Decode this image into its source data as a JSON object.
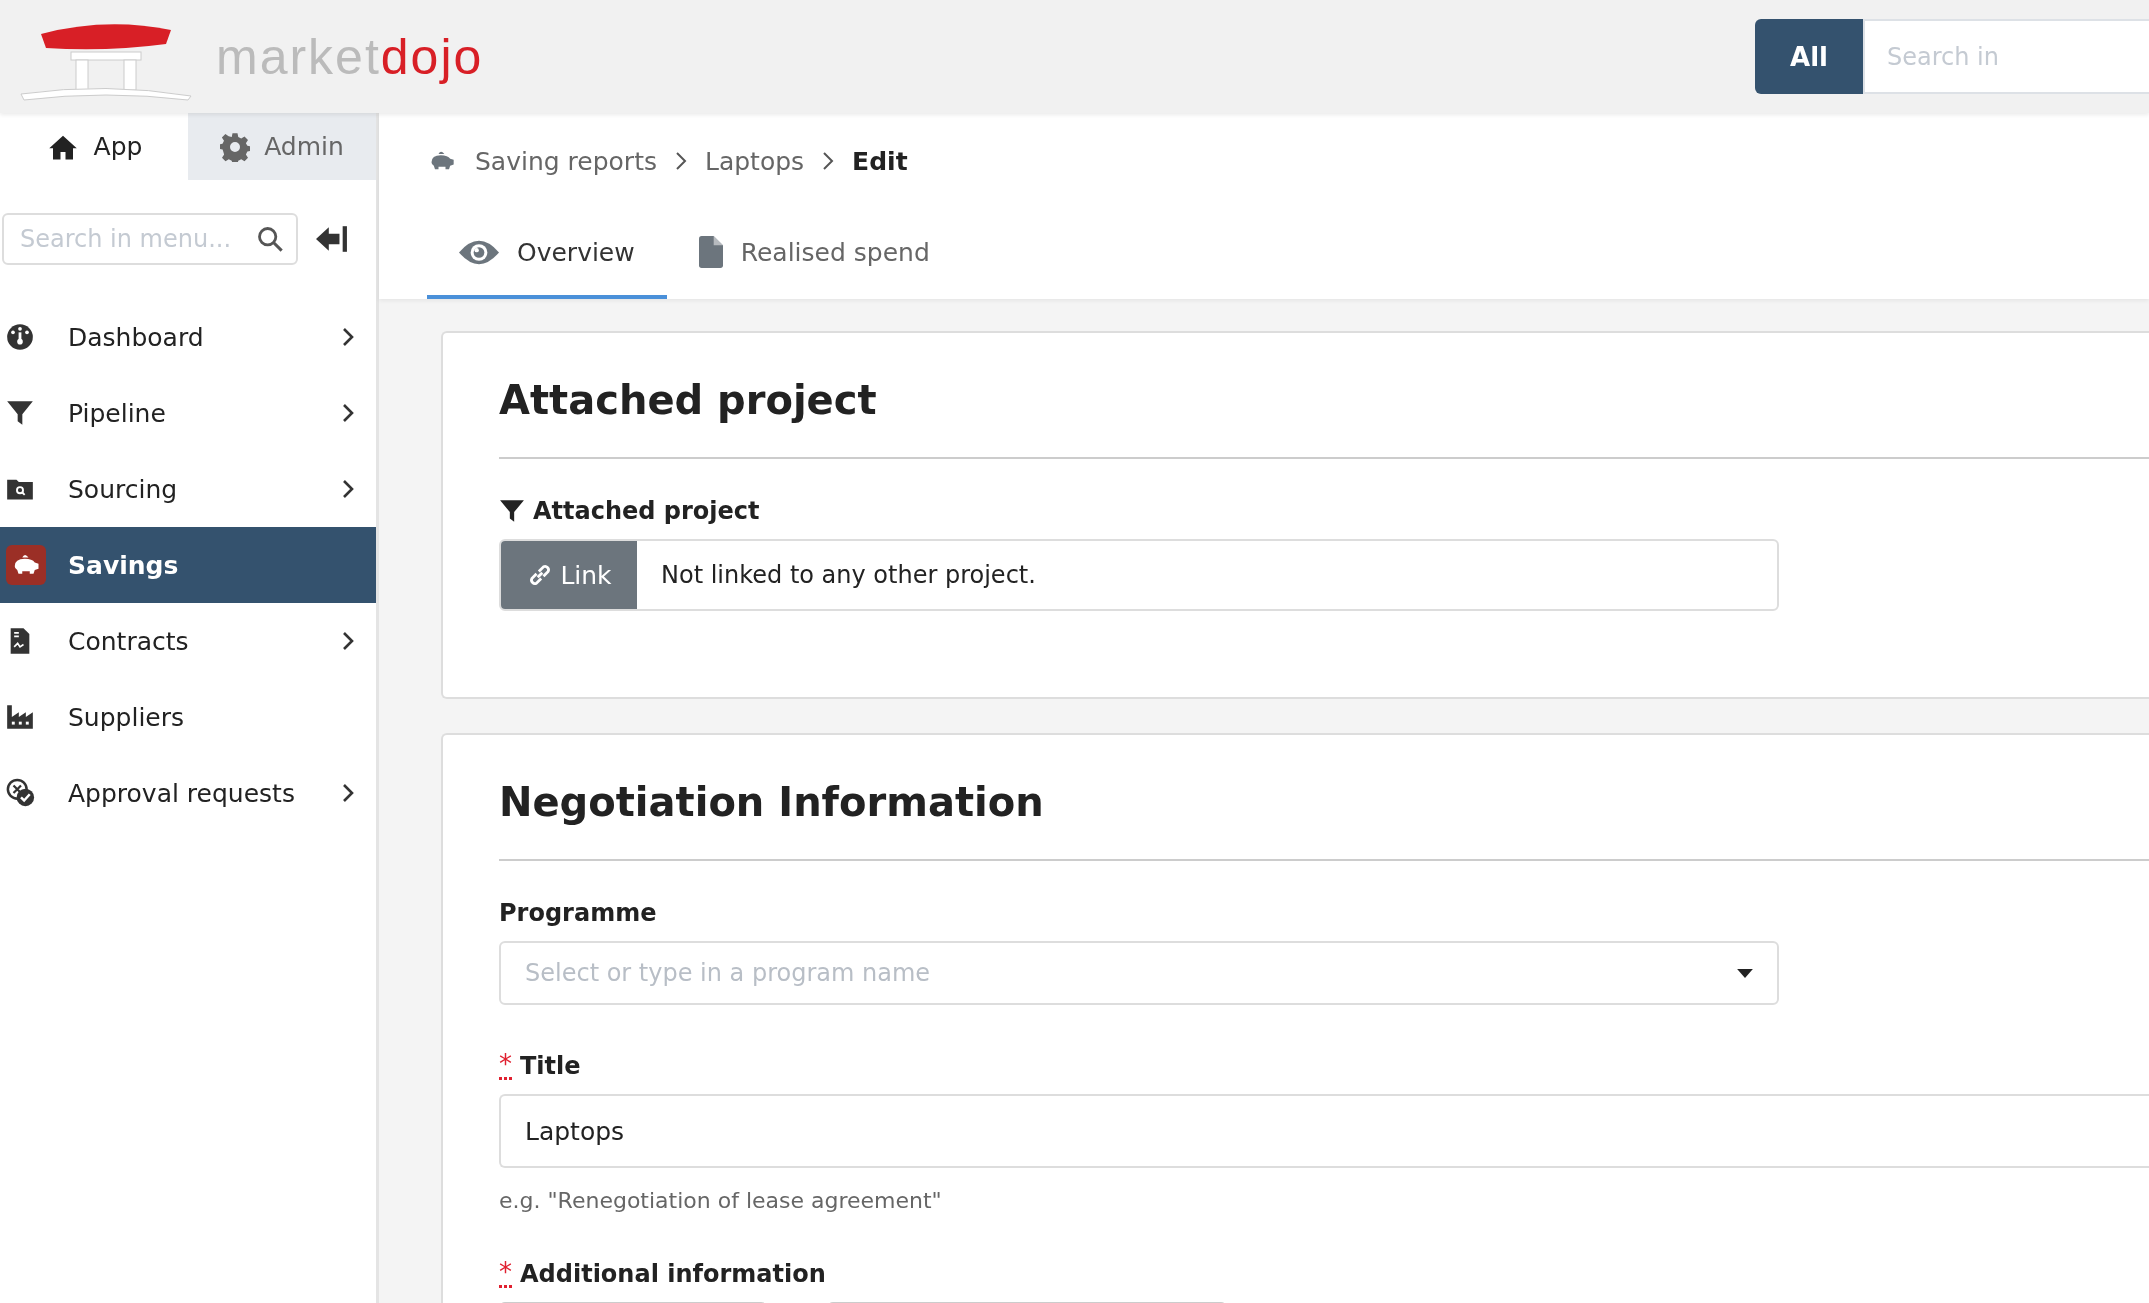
{
  "header": {
    "logo": {
      "part_1": "market",
      "part_2": "dojo"
    },
    "search_scope": "All",
    "search_placeholder": "Search in"
  },
  "sidebar": {
    "tabs": [
      {
        "label": "App",
        "selected": true,
        "kind": "home"
      },
      {
        "label": "Admin",
        "selected": false,
        "kind": "gear"
      }
    ],
    "search_placeholder": "Search in menu...",
    "items": [
      {
        "label": "Dashboard",
        "kind": "dashboard",
        "selected": false,
        "has_children": true
      },
      {
        "label": "Pipeline",
        "kind": "funnel",
        "selected": false,
        "has_children": true
      },
      {
        "label": "Sourcing",
        "kind": "folder",
        "selected": false,
        "has_children": true
      },
      {
        "label": "Savings",
        "kind": "piggy",
        "selected": true,
        "has_children": false
      },
      {
        "label": "Contracts",
        "kind": "contract",
        "selected": false,
        "has_children": true
      },
      {
        "label": "Suppliers",
        "kind": "factory",
        "selected": false,
        "has_children": false
      },
      {
        "label": "Approval requests",
        "kind": "approval",
        "selected": false,
        "has_children": true
      }
    ]
  },
  "breadcrumbs": [
    {
      "label": "Saving reports",
      "current": false
    },
    {
      "label": "Laptops",
      "current": false
    },
    {
      "label": "Edit",
      "current": true
    }
  ],
  "tabs": [
    {
      "label": "Overview",
      "selected": true,
      "kind": "eye"
    },
    {
      "label": "Realised spend",
      "selected": false,
      "kind": "file"
    }
  ],
  "sections": [
    {
      "title": "Attached project",
      "fields": [
        {
          "kind": "link",
          "label": "Attached project",
          "button": "Link",
          "value": "Not linked to any other project."
        }
      ]
    },
    {
      "title": "Negotiation Information",
      "fields": [
        {
          "kind": "select",
          "label": "Programme",
          "placeholder": "Select or type in a program name"
        },
        {
          "kind": "text",
          "label": "Title",
          "required_mark": "*",
          "value": "Laptops",
          "hint": "e.g. \"Renegotiation of lease agreement\""
        },
        {
          "kind": "editor",
          "label": "Additional information",
          "required_mark": "*"
        }
      ]
    }
  ]
}
